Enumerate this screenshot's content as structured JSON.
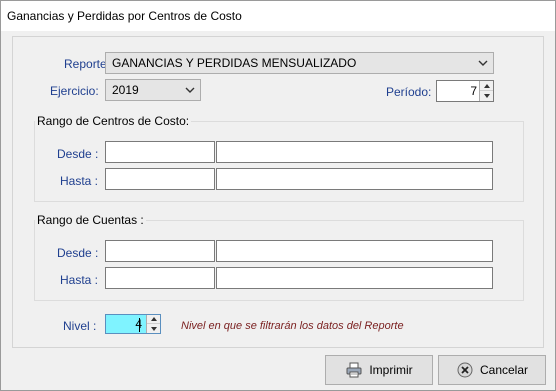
{
  "window": {
    "title": "Ganancias y Perdidas por Centros de Costo"
  },
  "form": {
    "reporte_label": "Reporte:",
    "reporte_value": "GANANCIAS Y PERDIDAS MENSUALIZADO",
    "ejercicio_label": "Ejercicio:",
    "ejercicio_value": "2019",
    "periodo_label": "Período:",
    "periodo_value": "7"
  },
  "centros": {
    "title": "Rango de Centros de Costo:",
    "desde_label": "Desde :",
    "hasta_label": "Hasta :",
    "desde_code": "",
    "desde_desc": "",
    "hasta_code": "",
    "hasta_desc": ""
  },
  "cuentas": {
    "title": "Rango de Cuentas :",
    "desde_label": "Desde :",
    "hasta_label": "Hasta :",
    "desde_code": "",
    "desde_desc": "",
    "hasta_code": "",
    "hasta_desc": ""
  },
  "nivel": {
    "label": "Nivel :",
    "value": "4",
    "hint": "Nivel en que se filtrarán los datos del Reporte"
  },
  "buttons": {
    "print_label": "Imprimir",
    "cancel_label": "Cancelar"
  },
  "icons": {
    "chevron": "chevron-down-icon",
    "printer": "printer-icon",
    "cancel": "cancel-icon"
  },
  "colors": {
    "label_blue": "#1f3f8f",
    "hint_red": "#7a1f1f",
    "nivel_highlight": "#7ff3ff"
  }
}
